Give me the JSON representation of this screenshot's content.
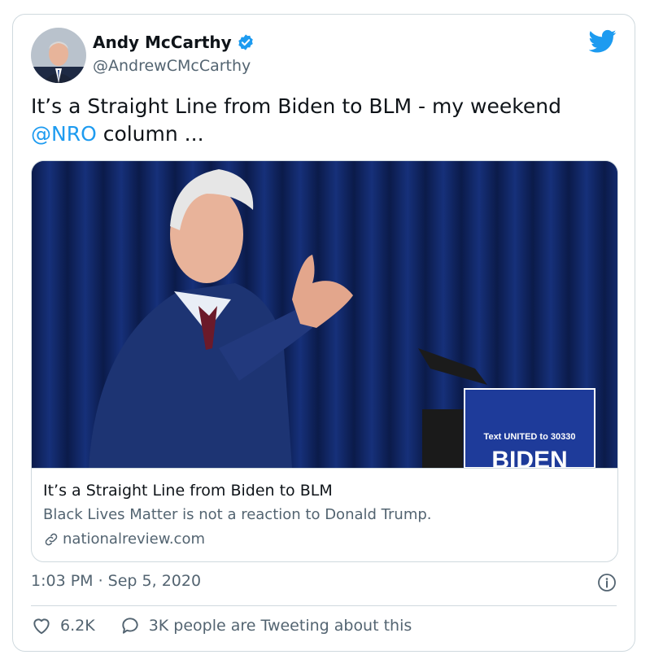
{
  "author": {
    "display_name": "Andy McCarthy",
    "handle": "@AndrewCMcCarthy"
  },
  "tweet": {
    "text_before": "It’s a Straight Line from Biden to BLM - my weekend ",
    "mention": "@NRO",
    "text_after": " column ..."
  },
  "link_card": {
    "title": "It’s a Straight Line from Biden to BLM",
    "description": "Black Lives Matter is not a reaction to Donald Trump.",
    "domain": "nationalreview.com",
    "sign_line": "Text UNITED to 30330",
    "sign_word": "BIDEN"
  },
  "timestamp": "1:03 PM · Sep 5, 2020",
  "actions": {
    "likes": "6.2K",
    "tweeting": "3K people are Tweeting about this"
  },
  "colors": {
    "accent": "#1d9bf0",
    "secondary_text": "#536471",
    "border": "#cfd9de"
  }
}
